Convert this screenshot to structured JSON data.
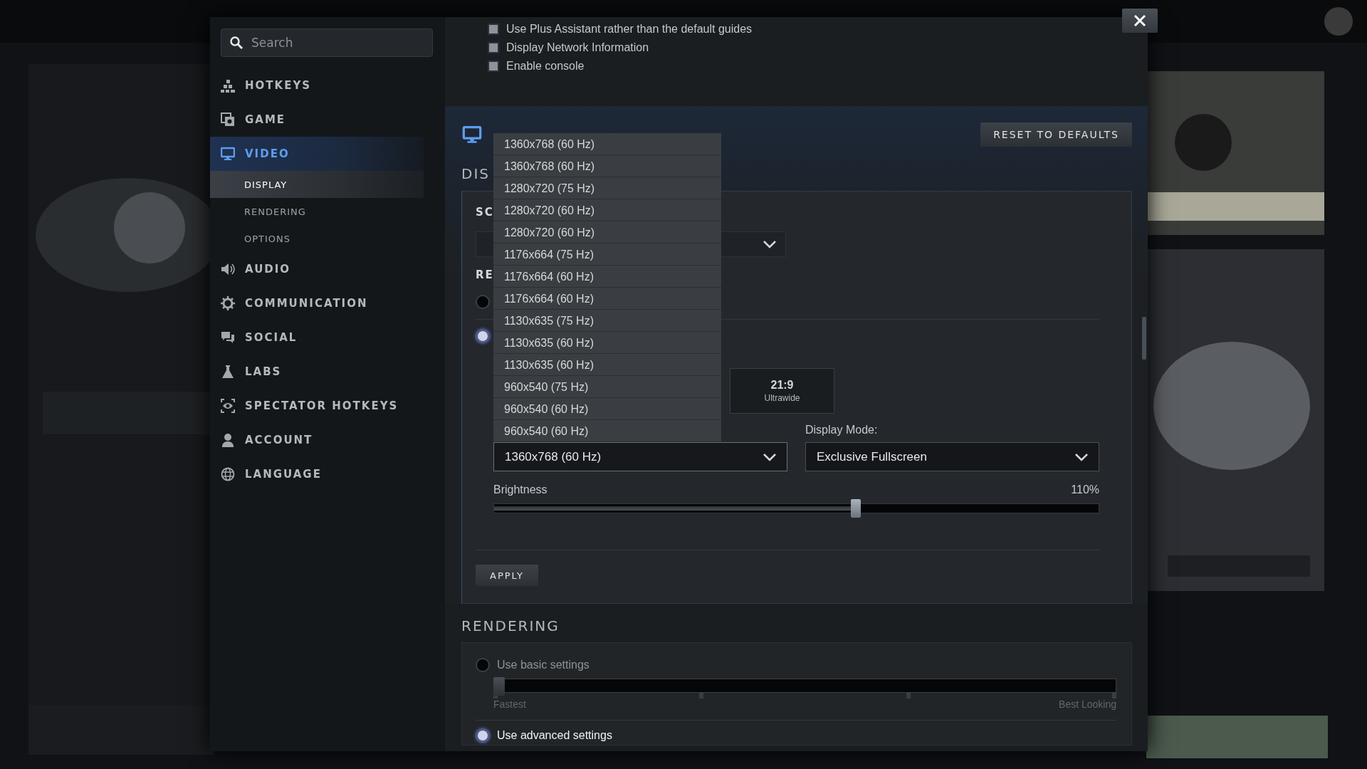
{
  "sidebar": {
    "search": {
      "placeholder": "Search"
    },
    "items": [
      {
        "label": "HOTKEYS",
        "selected": false
      },
      {
        "label": "GAME",
        "selected": false
      },
      {
        "label": "VIDEO",
        "selected": true,
        "children": [
          {
            "label": "DISPLAY",
            "selected": true
          },
          {
            "label": "RENDERING",
            "selected": false
          },
          {
            "label": "OPTIONS",
            "selected": false
          }
        ]
      },
      {
        "label": "AUDIO",
        "selected": false
      },
      {
        "label": "COMMUNICATION",
        "selected": false
      },
      {
        "label": "SOCIAL",
        "selected": false
      },
      {
        "label": "LABS",
        "selected": false
      },
      {
        "label": "SPECTATOR HOTKEYS",
        "selected": false
      },
      {
        "label": "ACCOUNT",
        "selected": false
      },
      {
        "label": "LANGUAGE",
        "selected": false
      }
    ]
  },
  "options": [
    {
      "label": "Use Plus Assistant rather than the default guides",
      "checked": false
    },
    {
      "label": "Display Network Information",
      "checked": false
    },
    {
      "label": "Enable console",
      "checked": false
    }
  ],
  "video": {
    "reset_button": "RESET TO DEFAULTS",
    "display": {
      "heading": "DIS",
      "label_1": "SC",
      "label_2": "RE",
      "radios": [
        {
          "selected": false
        },
        {
          "selected": true
        }
      ],
      "aspect_tile": {
        "ratio": "21:9",
        "name": "Ultrawide"
      },
      "resolution": {
        "value": "1360x768 (60 Hz)",
        "expanded": true,
        "options": [
          "1360x768 (60 Hz)",
          "1360x768 (60 Hz)",
          "1280x720 (75 Hz)",
          "1280x720 (60 Hz)",
          "1280x720 (60 Hz)",
          "1176x664 (75 Hz)",
          "1176x664 (60 Hz)",
          "1176x664 (60 Hz)",
          "1130x635 (75 Hz)",
          "1130x635 (60 Hz)",
          "1130x635 (60 Hz)",
          "960x540 (75 Hz)",
          "960x540 (60 Hz)",
          "960x540 (60 Hz)"
        ]
      },
      "display_mode": {
        "label": "Display Mode:",
        "value": "Exclusive Fullscreen"
      },
      "brightness": {
        "label": "Brightness",
        "reading": "110%",
        "level": 0.6
      },
      "apply_button": "APPLY"
    }
  },
  "rendering": {
    "heading": "RENDERING",
    "modes": [
      {
        "kind": "slider",
        "label": "Use basic settings",
        "selected": false,
        "level": 0,
        "min_label": "Fastest",
        "max_label": "Best Looking"
      },
      {
        "kind": "plain",
        "label": "Use advanced settings",
        "selected": true
      }
    ]
  }
}
